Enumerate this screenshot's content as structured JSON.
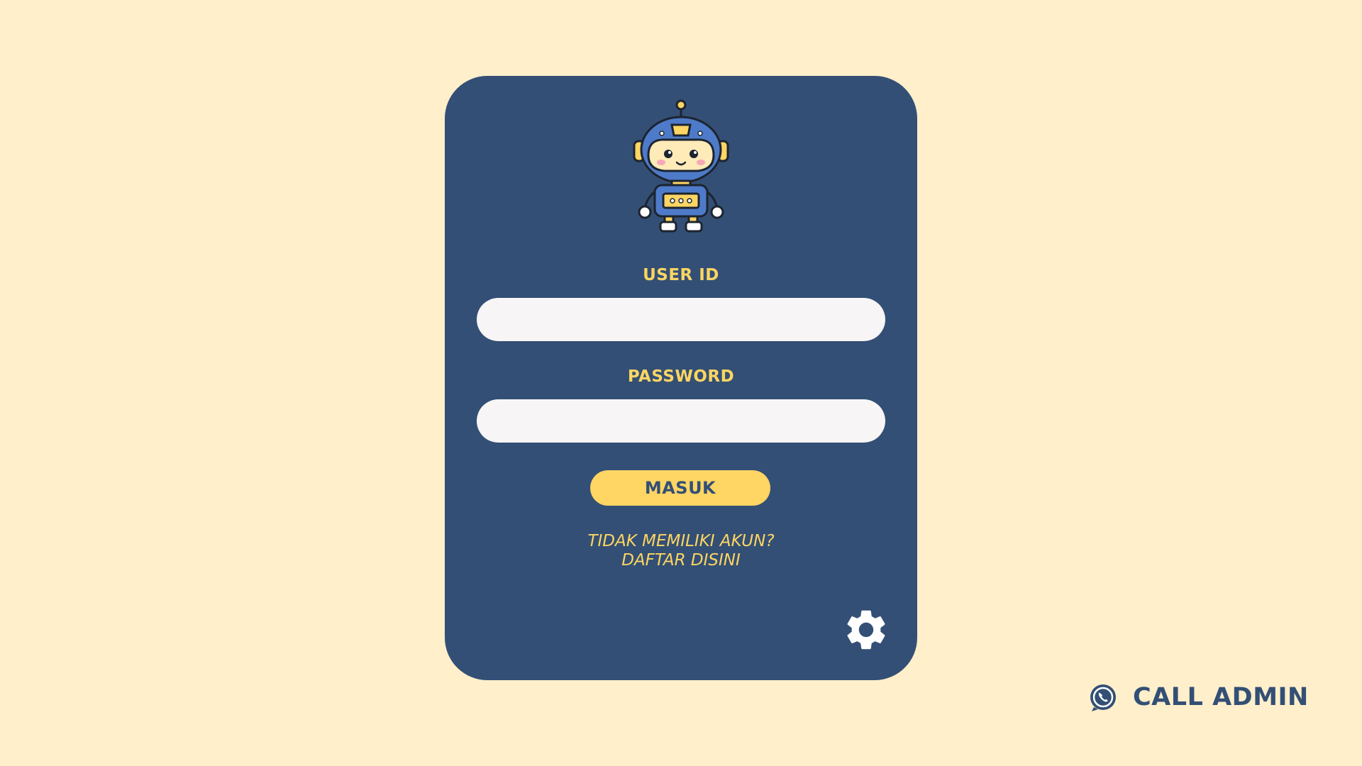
{
  "colors": {
    "background": "#FFEFCB",
    "card": "#334F75",
    "accent": "#FCD562",
    "button": "#FFD563",
    "input": "#F7F5F6"
  },
  "logo": {
    "icon": "robot-mascot-icon"
  },
  "form": {
    "user_id_label": "USER ID",
    "user_id_value": "",
    "password_label": "PASSWORD",
    "password_value": "",
    "submit_label": "MASUK"
  },
  "register": {
    "line1": "TIDAK MEMILIKI AKUN?",
    "line2": "DAFTAR DISINI"
  },
  "settings": {
    "icon": "gear-icon"
  },
  "call_admin": {
    "icon": "whatsapp-phone-icon",
    "label": "CALL ADMIN"
  }
}
